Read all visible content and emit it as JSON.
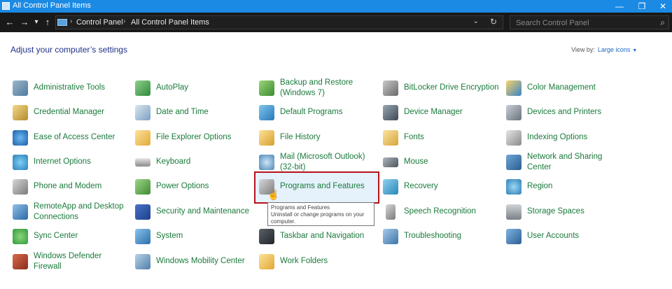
{
  "window": {
    "title": "All Control Panel Items",
    "controls": {
      "minimize": "—",
      "maximize": "❐",
      "close": "✕"
    }
  },
  "addressbar": {
    "back": "←",
    "forward": "→",
    "recent": "▾",
    "up": "↑",
    "separator": "›",
    "breadcrumbs": [
      "Control Panel",
      "All Control Panel Items"
    ],
    "dropdown": "⌄",
    "refresh": "↻",
    "search_placeholder": "Search Control Panel",
    "search_icon": "⌕"
  },
  "main": {
    "heading": "Adjust your computer’s settings",
    "view_by_label": "View by:",
    "view_by_value": "Large icons",
    "view_by_caret": "▼"
  },
  "columns": [
    [
      {
        "icon": "admin-tools-icon",
        "label": [
          "Administrative Tools"
        ]
      },
      {
        "icon": "credential-manager-icon",
        "label": [
          "Credential Manager"
        ]
      },
      {
        "icon": "ease-of-access-icon",
        "label": [
          "Ease of Access Center"
        ]
      },
      {
        "icon": "internet-options-icon",
        "label": [
          "Internet Options"
        ]
      },
      {
        "icon": "phone-modem-icon",
        "label": [
          "Phone and Modem"
        ]
      },
      {
        "icon": "remoteapp-icon",
        "label": [
          "RemoteApp and Desktop",
          "Connections"
        ]
      },
      {
        "icon": "sync-center-icon",
        "label": [
          "Sync Center"
        ]
      },
      {
        "icon": "windows-defender-firewall-icon",
        "label": [
          "Windows Defender",
          "Firewall"
        ]
      }
    ],
    [
      {
        "icon": "autoplay-icon",
        "label": [
          "AutoPlay"
        ]
      },
      {
        "icon": "date-time-icon",
        "label": [
          "Date and Time"
        ]
      },
      {
        "icon": "file-explorer-options-icon",
        "label": [
          "File Explorer Options"
        ]
      },
      {
        "icon": "keyboard-icon",
        "label": [
          "Keyboard"
        ]
      },
      {
        "icon": "power-options-icon",
        "label": [
          "Power Options"
        ]
      },
      {
        "icon": "security-maintenance-icon",
        "label": [
          "Security and Maintenance"
        ]
      },
      {
        "icon": "system-icon",
        "label": [
          "System"
        ]
      },
      {
        "icon": "windows-mobility-center-icon",
        "label": [
          "Windows Mobility Center"
        ]
      }
    ],
    [
      {
        "icon": "backup-restore-icon",
        "label": [
          "Backup and Restore",
          "(Windows 7)"
        ]
      },
      {
        "icon": "default-programs-icon",
        "label": [
          "Default Programs"
        ]
      },
      {
        "icon": "file-history-icon",
        "label": [
          "File History"
        ]
      },
      {
        "icon": "mail-icon",
        "label": [
          "Mail (Microsoft Outlook)",
          "(32-bit)"
        ]
      },
      {
        "icon": "programs-features-icon",
        "label": [
          "Programs and Features"
        ]
      },
      {
        "icon": "",
        "label": [
          ""
        ]
      },
      {
        "icon": "taskbar-navigation-icon",
        "label": [
          "Taskbar and Navigation"
        ]
      },
      {
        "icon": "work-folders-icon",
        "label": [
          "Work Folders"
        ]
      }
    ],
    [
      {
        "icon": "bitlocker-icon",
        "label": [
          "BitLocker Drive Encryption"
        ]
      },
      {
        "icon": "device-manager-icon",
        "label": [
          "Device Manager"
        ]
      },
      {
        "icon": "fonts-icon",
        "label": [
          "Fonts"
        ]
      },
      {
        "icon": "mouse-icon",
        "label": [
          "Mouse"
        ]
      },
      {
        "icon": "recovery-icon",
        "label": [
          "Recovery"
        ]
      },
      {
        "icon": "speech-recognition-icon",
        "label": [
          "Speech Recognition"
        ]
      },
      {
        "icon": "troubleshooting-icon",
        "label": [
          "Troubleshooting"
        ]
      },
      {
        "icon": "",
        "label": [
          ""
        ]
      }
    ],
    [
      {
        "icon": "color-management-icon",
        "label": [
          "Color Management"
        ]
      },
      {
        "icon": "devices-printers-icon",
        "label": [
          "Devices and Printers"
        ]
      },
      {
        "icon": "indexing-options-icon",
        "label": [
          "Indexing Options"
        ]
      },
      {
        "icon": "network-sharing-icon",
        "label": [
          "Network and Sharing",
          "Center"
        ]
      },
      {
        "icon": "region-icon",
        "label": [
          "Region"
        ]
      },
      {
        "icon": "storage-spaces-icon",
        "label": [
          "Storage Spaces"
        ]
      },
      {
        "icon": "user-accounts-icon",
        "label": [
          "User Accounts"
        ]
      },
      {
        "icon": "",
        "label": [
          ""
        ]
      }
    ]
  ],
  "tooltip": {
    "title": "Programs and Features",
    "line1": "Uninstall or change programs on your",
    "line2": "computer."
  },
  "colors": {
    "titlebar": "#1b8ae4",
    "link_green": "#1a7a3c",
    "heading_blue": "#1e3287",
    "highlight_border": "#b5121b"
  }
}
